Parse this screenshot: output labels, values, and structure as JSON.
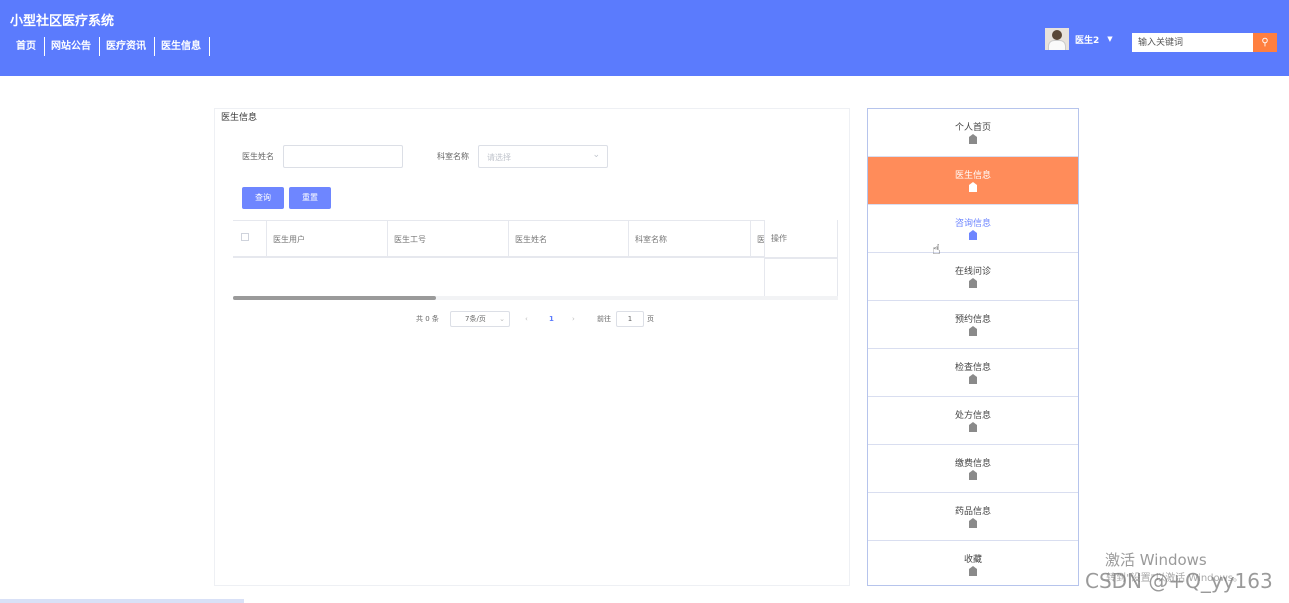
{
  "header": {
    "site_title": "小型社区医疗系统",
    "nav": [
      "首页",
      "网站公告",
      "医疗资讯",
      "医生信息"
    ],
    "user_name": "医生2",
    "search_placeholder": "输入关键词",
    "colors": {
      "header_bg": "#5b7bfd",
      "search_button": "#ff7f3f"
    }
  },
  "panel": {
    "title": "医生信息",
    "filters": {
      "doctor_name_label": "医生姓名",
      "doctor_name_value": "",
      "dept_label": "科室名称",
      "dept_placeholder": "请选择"
    },
    "buttons": {
      "query": "查询",
      "reset": "重置"
    },
    "table": {
      "columns": [
        "医生用户",
        "医生工号",
        "医生姓名",
        "科室名称",
        "医"
      ],
      "action_column": "操作",
      "rows": []
    },
    "pagination": {
      "total": "共 0 条",
      "page_size": "7条/页",
      "current_page": "1",
      "goto_label": "前往",
      "goto_value": "1",
      "page_unit": "页",
      "prev_icon": "chevron-left-icon",
      "next_icon": "chevron-right-icon"
    }
  },
  "sidebar": {
    "items": [
      "个人首页",
      "医生信息",
      "咨询信息",
      "在线问诊",
      "预约信息",
      "检查信息",
      "处方信息",
      "缴费信息",
      "药品信息",
      "收藏"
    ],
    "active_item": "医生信息",
    "hover_item": "咨询信息",
    "colors": {
      "active_bg": "#ff8c5a",
      "hover_text": "#6e86ff",
      "border": "#b6c4ec"
    }
  },
  "watermark": {
    "windows_line1": "激活 Windows",
    "windows_line2": "转到\"设置\"以激活 Windows。",
    "csdn": "CSDN @+Q_yy163"
  }
}
